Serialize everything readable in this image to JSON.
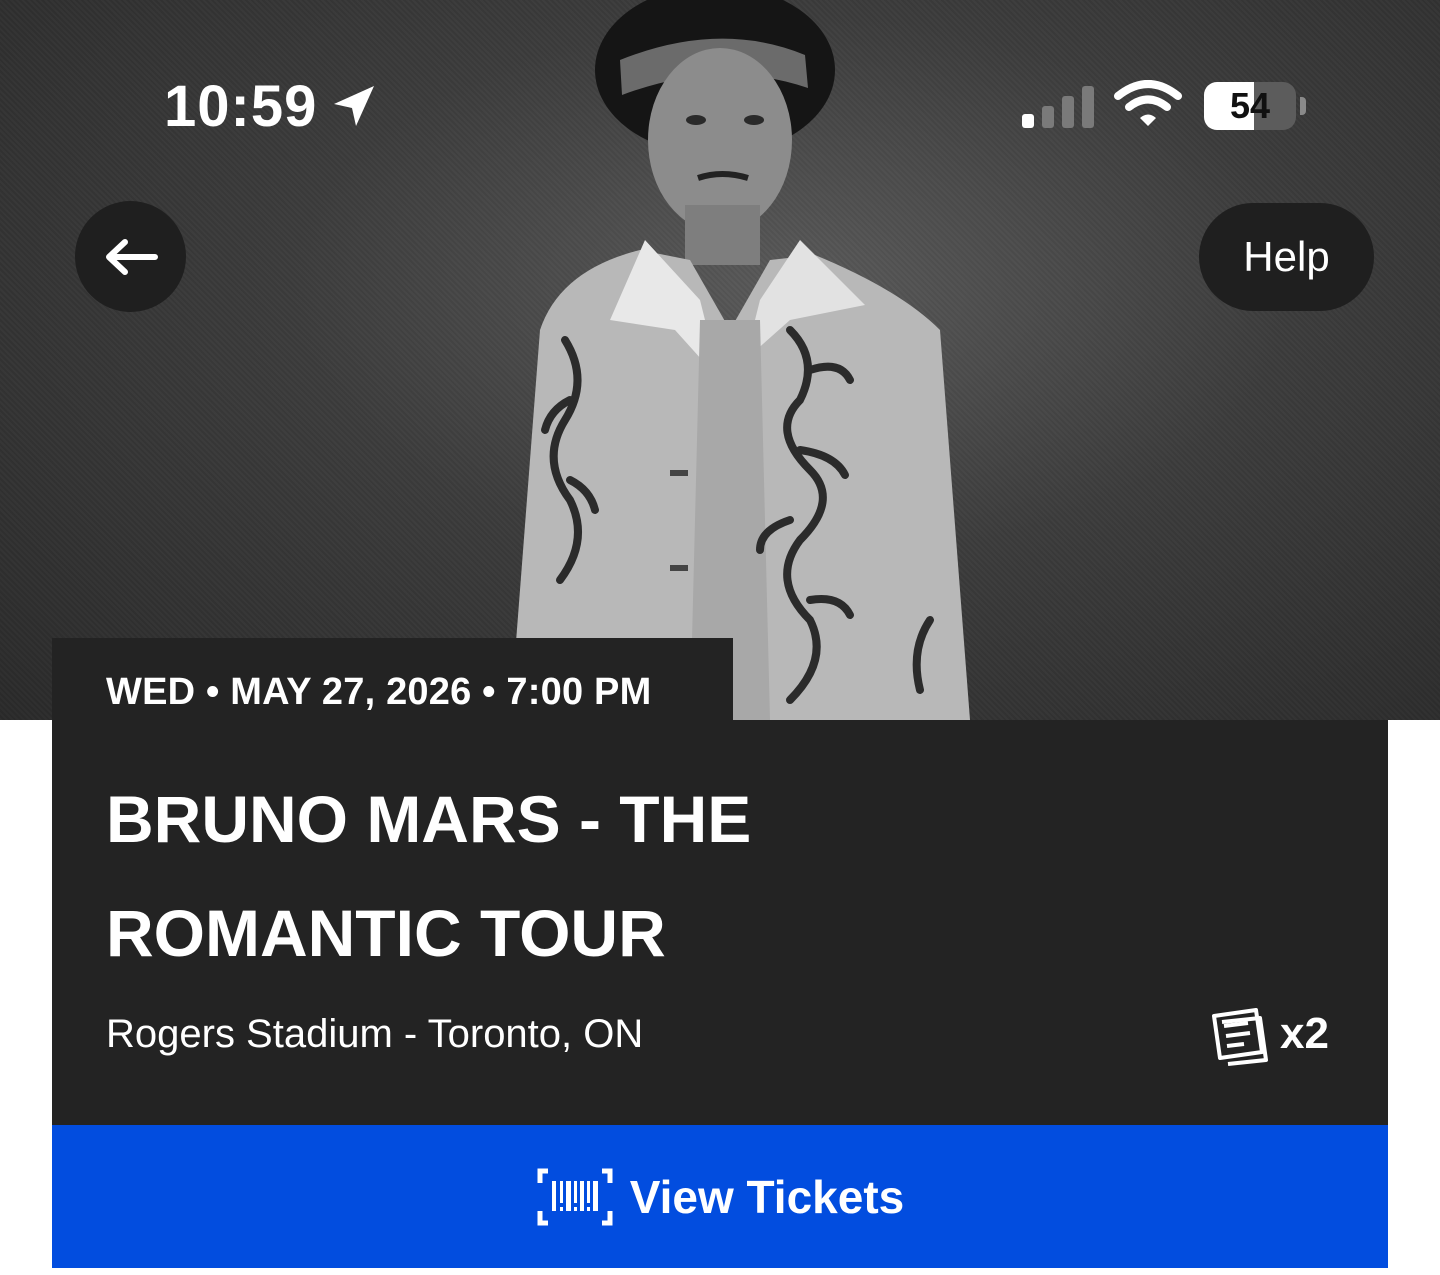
{
  "status_bar": {
    "time": "10:59",
    "battery_percent": 54,
    "battery_label": "54",
    "signal_bars_active": 1,
    "signal_bars_total": 4
  },
  "nav": {
    "back_icon": "arrow-left-icon",
    "help_label": "Help"
  },
  "event": {
    "date_line": "WED • MAY 27, 2026 • 7:00 PM",
    "title": "BRUNO MARS - THE ROMANTIC TOUR",
    "venue": "Rogers Stadium - Toronto, ON",
    "ticket_count": "x2",
    "ticket_icon": "tickets-icon"
  },
  "actions": {
    "view_tickets_label": "View Tickets",
    "view_tickets_icon": "barcode-icon"
  },
  "colors": {
    "accent": "#024ddf",
    "card_bg": "#232323",
    "button_bg": "#1f1f1f",
    "text": "#ffffff"
  }
}
